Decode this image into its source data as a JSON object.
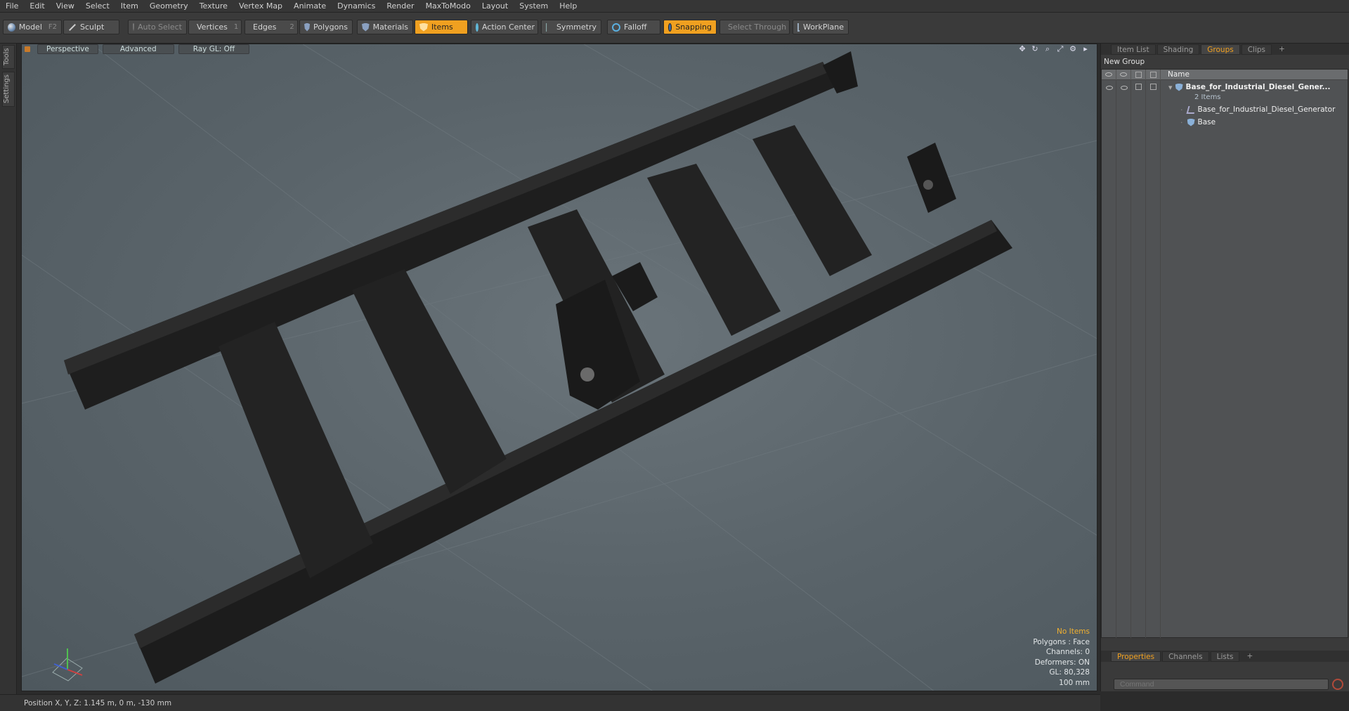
{
  "menu": [
    "File",
    "Edit",
    "View",
    "Select",
    "Item",
    "Geometry",
    "Texture",
    "Vertex Map",
    "Animate",
    "Dynamics",
    "Render",
    "MaxToModo",
    "Layout",
    "System",
    "Help"
  ],
  "toolbar": {
    "model": "Model",
    "model_key": "F2",
    "sculpt": "Sculpt",
    "auto_select": "Auto Select",
    "vertices": "Vertices",
    "vertices_key": "1",
    "edges": "Edges",
    "edges_key": "2",
    "polygons": "Polygons",
    "materials": "Materials",
    "items": "Items",
    "action_center": "Action Center",
    "symmetry": "Symmetry",
    "falloff": "Falloff",
    "snapping": "Snapping",
    "select_through": "Select Through",
    "workplane": "WorkPlane"
  },
  "left_tabs": [
    "Tools",
    "Settings"
  ],
  "viewport": {
    "perspective": "Perspective",
    "advanced": "Advanced",
    "raygl": "Ray GL: Off",
    "stats": {
      "no_items": "No Items",
      "polygons": "Polygons : Face",
      "channels": "Channels: 0",
      "deformers": "Deformers: ON",
      "gl": "GL: 80,328",
      "scale": "100 mm"
    }
  },
  "right_panel": {
    "tabs": [
      "Item List",
      "Shading",
      "Groups",
      "Clips",
      "+"
    ],
    "active_tab": "Groups",
    "new_group": "New Group",
    "name_col": "Name",
    "group_name": "Base_for_Industrial_Diesel_Gener...",
    "group_count": "2 Items",
    "children": [
      "Base_for_Industrial_Diesel_Generator",
      "Base"
    ],
    "bottom_tabs": [
      "Properties",
      "Channels",
      "Lists",
      "+"
    ],
    "command_placeholder": "Command"
  },
  "statusbar": {
    "position": "Position X, Y, Z:   1.145 m, 0 m, -130 mm"
  },
  "colors": {
    "accent": "#f0a020",
    "viewport_bg": "#5a646a",
    "frame": "#1c1c1c"
  }
}
